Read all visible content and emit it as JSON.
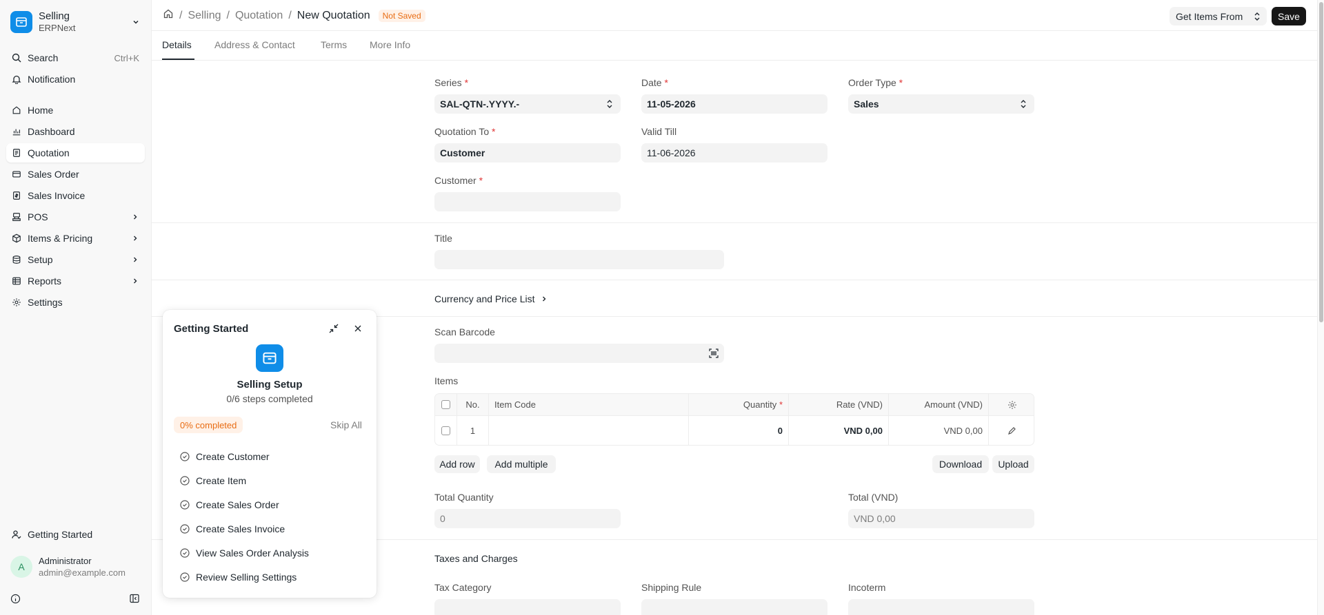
{
  "sidebar": {
    "app_title": "Selling",
    "app_subtitle": "ERPNext",
    "search_label": "Search",
    "search_shortcut": "Ctrl+K",
    "notification_label": "Notification",
    "items": [
      {
        "label": "Home",
        "icon": "home-icon"
      },
      {
        "label": "Dashboard",
        "icon": "chart-icon"
      },
      {
        "label": "Quotation",
        "icon": "document-icon",
        "active": true
      },
      {
        "label": "Sales Order",
        "icon": "card-icon"
      },
      {
        "label": "Sales Invoice",
        "icon": "invoice-icon"
      },
      {
        "label": "POS",
        "icon": "pos-icon",
        "expandable": true
      },
      {
        "label": "Items & Pricing",
        "icon": "box-icon",
        "expandable": true
      },
      {
        "label": "Setup",
        "icon": "database-icon",
        "expandable": true
      },
      {
        "label": "Reports",
        "icon": "table-icon",
        "expandable": true
      },
      {
        "label": "Settings",
        "icon": "gear-icon"
      }
    ],
    "getting_started_label": "Getting Started",
    "user_initial": "A",
    "user_name": "Administrator",
    "user_email": "admin@example.com"
  },
  "header": {
    "breadcrumbs": [
      "Selling",
      "Quotation"
    ],
    "current": "New Quotation",
    "status_badge": "Not Saved",
    "get_items_label": "Get Items From",
    "save_label": "Save"
  },
  "tabs": [
    "Details",
    "Address & Contact",
    "Terms",
    "More Info"
  ],
  "form": {
    "series_label": "Series",
    "series_value": "SAL-QTN-.YYYY.-",
    "date_label": "Date",
    "date_value": "11-05-2026",
    "order_type_label": "Order Type",
    "order_type_value": "Sales",
    "quotation_to_label": "Quotation To",
    "quotation_to_value": "Customer",
    "valid_till_label": "Valid Till",
    "valid_till_value": "11-06-2026",
    "customer_label": "Customer",
    "customer_value": "",
    "title_label": "Title",
    "title_value": "",
    "currency_section": "Currency and Price List",
    "scan_barcode_label": "Scan Barcode",
    "items_label": "Items",
    "items_columns": [
      "No.",
      "Item Code",
      "Quantity",
      "Rate (VND)",
      "Amount (VND)"
    ],
    "items_rows": [
      {
        "no": "1",
        "item_code": "",
        "quantity": "0",
        "rate": "VND 0,00",
        "amount": "VND 0,00"
      }
    ],
    "add_row_label": "Add row",
    "add_multiple_label": "Add multiple",
    "download_label": "Download",
    "upload_label": "Upload",
    "total_quantity_label": "Total Quantity",
    "total_quantity_value": "0",
    "total_label": "Total (VND)",
    "total_value": "VND 0,00",
    "taxes_section": "Taxes and Charges",
    "tax_category_label": "Tax Category",
    "shipping_rule_label": "Shipping Rule",
    "incoterm_label": "Incoterm"
  },
  "getting_started": {
    "title": "Getting Started",
    "heading": "Selling Setup",
    "progress_text": "0/6 steps completed",
    "percent_label": "0% completed",
    "percent_value": 0,
    "skip_label": "Skip All",
    "steps": [
      "Create Customer",
      "Create Item",
      "Create Sales Order",
      "Create Sales Invoice",
      "View Sales Order Analysis",
      "Review Selling Settings"
    ]
  },
  "colors": {
    "brand": "#0f8de8",
    "save_button": "#171717",
    "badge_text": "#e86c13",
    "badge_bg": "#fff1e7",
    "required": "#e03636"
  }
}
